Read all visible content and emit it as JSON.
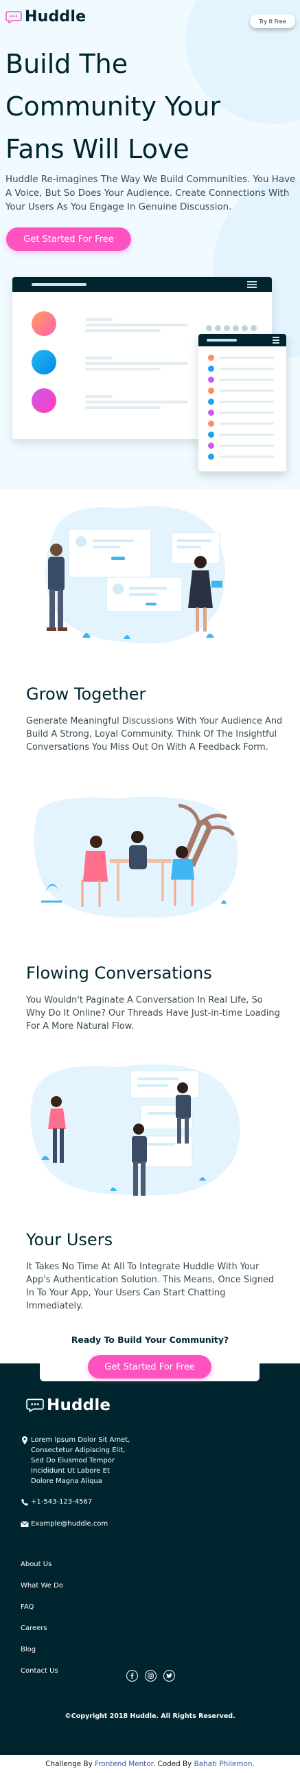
{
  "brand": {
    "name": "Huddle",
    "colors": {
      "dark": "#00252e",
      "pink": "#ff52c1",
      "light_bg": "#f0faff",
      "link": "#3e52a3"
    }
  },
  "header": {
    "cta_label": "Try It Free"
  },
  "hero": {
    "title_lines": [
      "Build The",
      "Community Your",
      "Fans Will Love"
    ],
    "text": "Huddle Re-imagines The Way We Build Communities. You Have A Voice, But So Does Your Audience. Create Connections With Your Users As You Engage In Genuine Discussion.",
    "cta_label": "Get Started For Free"
  },
  "features": [
    {
      "title": "Grow Together",
      "text": "Generate Meaningful Discussions With Your Audience And Build A Strong, Loyal Community. Think Of The Insightful Conversations You Miss Out On With A Feedback Form."
    },
    {
      "title": "Flowing Conversations",
      "text": "You Wouldn't Paginate A Conversation In Real Life, So Why Do It Online? Our Threads Have Just-in-time Loading For A More Natural Flow."
    },
    {
      "title": "Your Users",
      "text": "It Takes No Time At All To Integrate Huddle With Your App's Authentication Solution. This Means, Once Signed In To Your App, Your Users Can Start Chatting Immediately."
    }
  ],
  "cta": {
    "title": "Ready To Build Your Community?",
    "button_label": "Get Started For Free"
  },
  "footer": {
    "address": "Lorem Ipsum Dolor Sit Amet, Consectetur Adipiscing Elit, Sed Do Eiusmod Tempor Incididunt Ut Labore Et Dolore Magna Aliqua",
    "phone": "+1-543-123-4567",
    "email": "Example@huddle.com",
    "links": [
      "About Us",
      "What We Do",
      "FAQ",
      "Careers",
      "Blog",
      "Contact Us"
    ],
    "social_icons": [
      "facebook-icon",
      "instagram-icon",
      "twitter-icon"
    ],
    "copyright": "©Copyright 2018 Huddle. All Rights Reserved."
  },
  "attribution": {
    "prefix": "Challenge By",
    "mentor": "Frontend Mentor",
    "middle": ". Coded By",
    "author": "Bahati Philemon",
    "suffix": "."
  }
}
